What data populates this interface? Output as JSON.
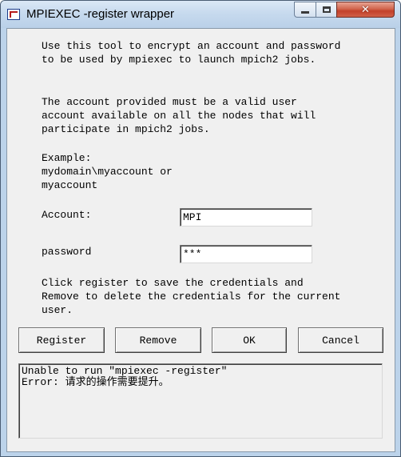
{
  "window": {
    "title": "MPIEXEC -register wrapper",
    "controls": {
      "minimize_icon": "minimize-icon",
      "maximize_icon": "maximize-icon",
      "close_icon": "close-icon",
      "close_glyph": "✕"
    }
  },
  "intro": {
    "line1": "Use this tool to encrypt an account and password",
    "line2": "to be used by mpiexec to launch mpich2 jobs."
  },
  "account_note": {
    "line1": "The account provided must be a valid user",
    "line2": "account available on all the nodes that will",
    "line3": "participate in mpich2 jobs."
  },
  "example": {
    "label": "Example:",
    "line1": "mydomain\\myaccount or",
    "line2": "myaccount"
  },
  "form": {
    "account_label": "Account:",
    "account_value": "MPI",
    "password_label": "password",
    "password_value": "***"
  },
  "instructions": {
    "line1": "Click register to save the credentials and",
    "line2": "Remove to delete the credentials for the current",
    "line3": "user."
  },
  "buttons": {
    "register": "Register",
    "remove": "Remove",
    "ok": "OK",
    "cancel": "Cancel"
  },
  "output": {
    "line1": "Unable to run \"mpiexec -register\"",
    "line2": "Error: 请求的操作需要提升。"
  },
  "colors": {
    "title_bar": "#c7daee",
    "close_button": "#c3402a",
    "client_bg": "#f0f0f0"
  }
}
